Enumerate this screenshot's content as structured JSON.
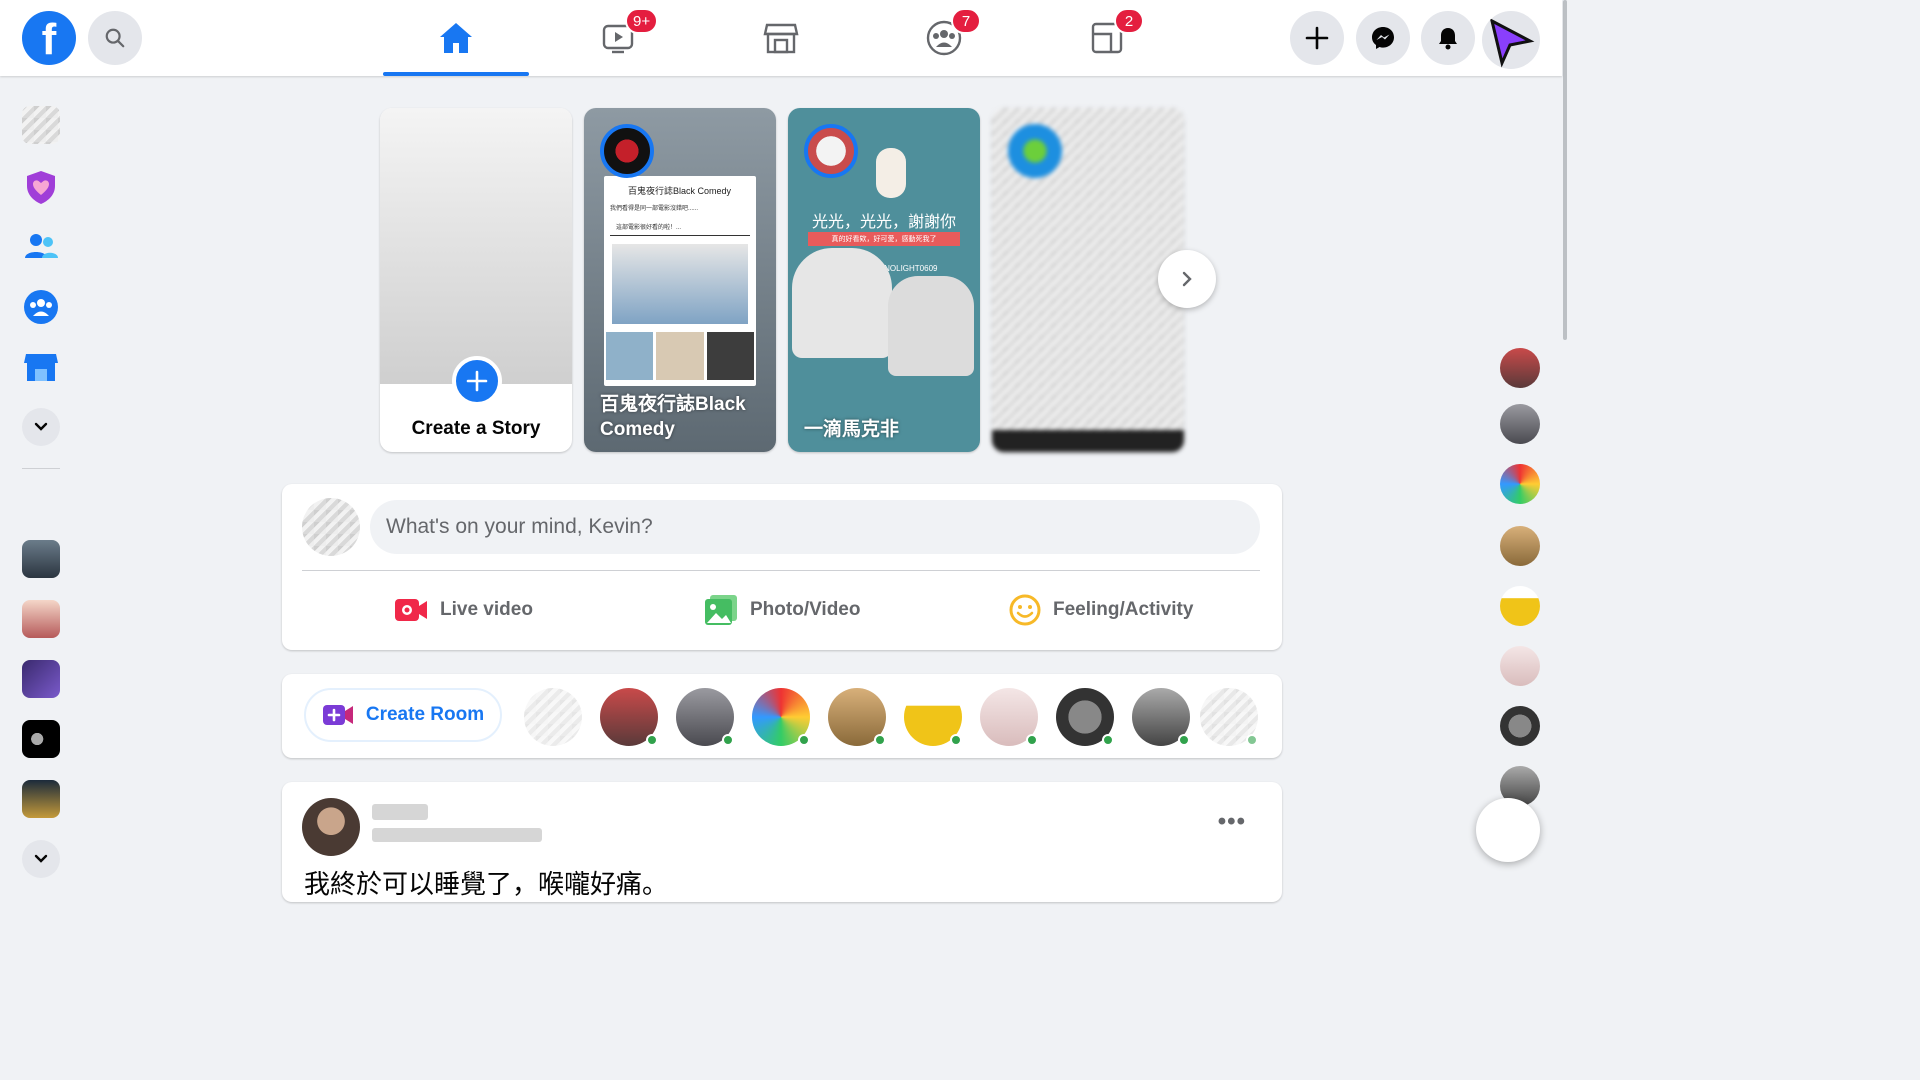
{
  "topbar": {
    "logo": "f",
    "badges": {
      "watch": "9+",
      "groups": "7",
      "gaming": "2"
    }
  },
  "stories": {
    "create_label": "Create a Story",
    "items": [
      {
        "name": "百鬼夜行誌Black Comedy",
        "card_title": "百鬼夜行誌Black Comedy",
        "card_caption": "我們看得是同一部電影沒錯吧......",
        "card_subcaption": "這部電影很好看的啦！..."
      },
      {
        "name": "一滴馬克非",
        "headline": "光光，光光，謝謝你",
        "sub": "真的好看欸，好可愛，感動死我了",
        "tag": "@NOLIGHT0609"
      }
    ]
  },
  "composer": {
    "placeholder": "What's on your mind, Kevin?",
    "actions": {
      "live": "Live video",
      "photo": "Photo/Video",
      "feeling": "Feeling/Activity"
    }
  },
  "rooms": {
    "create_label": "Create Room"
  },
  "post": {
    "more": "•••",
    "text": "我終於可以睡覺了，喉嚨好痛。"
  },
  "colors": {
    "brand": "#1877f2",
    "badge": "#e41e3f",
    "live": "#f02849",
    "photo": "#45bd62",
    "feeling": "#f7b928",
    "online": "#31a24c",
    "room": "#7b3bd6"
  }
}
